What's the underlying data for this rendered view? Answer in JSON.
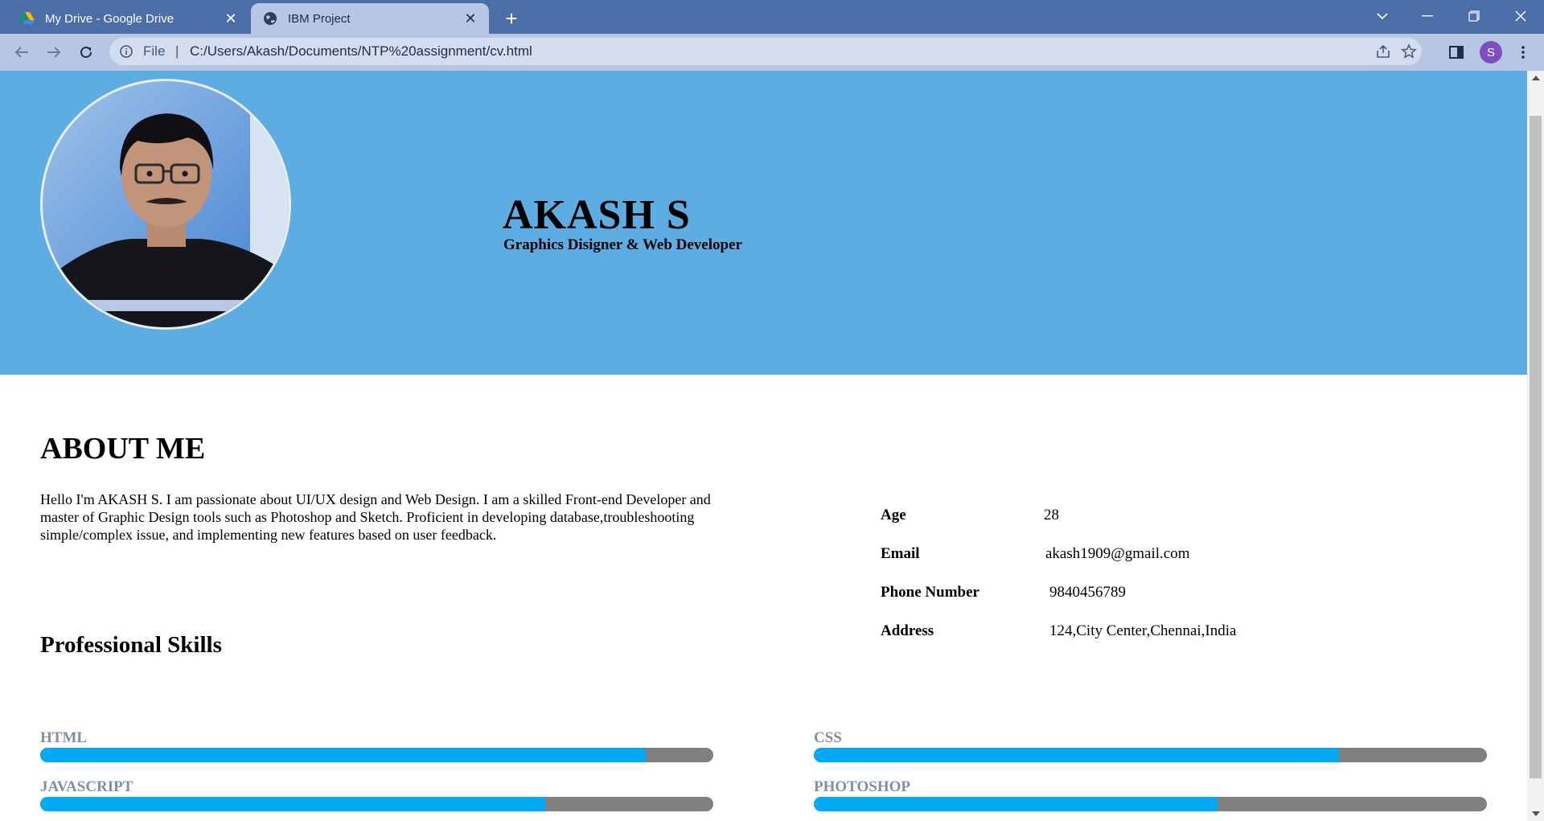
{
  "browser": {
    "tabs": [
      {
        "title": "My Drive - Google Drive",
        "icon": "google-drive-icon",
        "active": false
      },
      {
        "title": "IBM Project",
        "icon": "globe-icon",
        "active": true
      }
    ],
    "new_tab_label": "+",
    "address": {
      "scheme": "File",
      "separator": "|",
      "url": "C:/Users/Akash/Documents/NTP%20assignment/cv.html"
    },
    "profile_initial": "S",
    "colors": {
      "titlebar": "#4b6ea8",
      "toolbar": "#b7c6e5",
      "avatar": "#7b4fc0"
    }
  },
  "header": {
    "name": "AKASH S",
    "tagline": "Graphics Disigner & Web Developer",
    "background_color": "#5dade2"
  },
  "about": {
    "heading": "ABOUT ME",
    "text": "Hello I'm AKASH S. I am passionate about UI/UX design and Web Design. I am a skilled Front-end Developer and master of Graphic Design tools such as Photoshop and Sketch. Proficient in developing database,troubleshooting simple/complex issue, and implementing new features based on user feedback."
  },
  "info": [
    {
      "label": "Age",
      "value": "28"
    },
    {
      "label": "Email",
      "value": "akash1909@gmail.com"
    },
    {
      "label": "Phone Number",
      "value": "9840456789"
    },
    {
      "label": "Address",
      "value": "124,City Center,Chennai,India"
    }
  ],
  "skills": {
    "heading": "Professional Skills",
    "items": [
      {
        "name": "HTML",
        "level_percent": 90
      },
      {
        "name": "CSS",
        "level_percent": 78
      },
      {
        "name": "JAVASCRIPT",
        "level_percent": 75
      },
      {
        "name": "PHOTOSHOP",
        "level_percent": 60
      }
    ],
    "fill_color": "#03a9f4",
    "track_color": "#808080"
  }
}
